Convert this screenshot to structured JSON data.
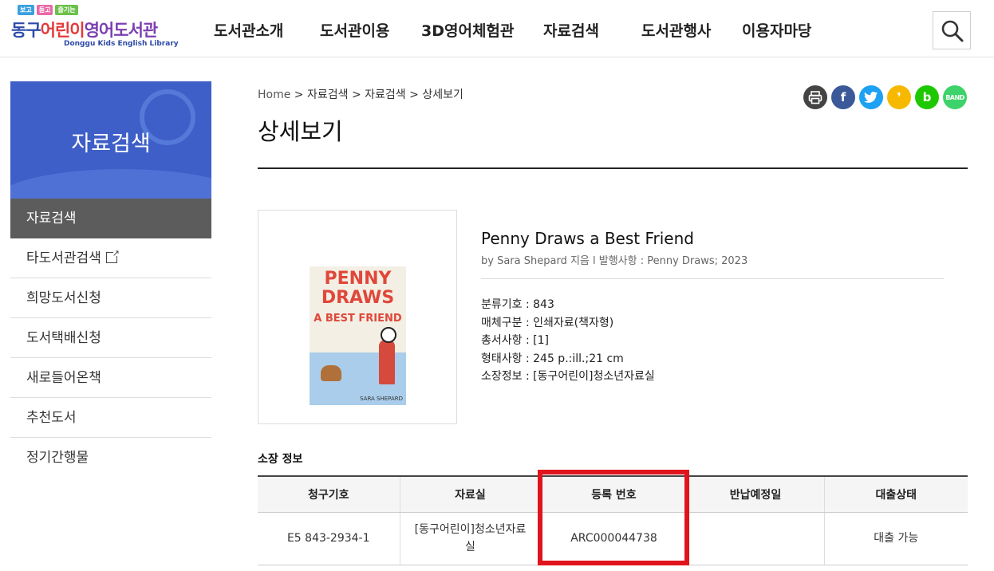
{
  "header": {
    "logo": {
      "tags": [
        "보고",
        "듣고",
        "즐기는"
      ],
      "title_part1": "동구",
      "title_part2": "어린이",
      "title_part3": "영어도서관",
      "subtitle": "Donggu Kids English Library"
    },
    "nav": [
      "도서관소개",
      "도서관이용",
      "3D영어체험관",
      "자료검색",
      "도서관행사",
      "이용자마당"
    ]
  },
  "sidebar": {
    "title": "자료검색",
    "items": [
      {
        "label": "자료검색"
      },
      {
        "label": "타도서관검색"
      },
      {
        "label": "희망도서신청"
      },
      {
        "label": "도서택배신청"
      },
      {
        "label": "새로들어온책"
      },
      {
        "label": "추천도서"
      },
      {
        "label": "정기간행물"
      }
    ]
  },
  "breadcrumb": {
    "home": "Home",
    "sep": " > ",
    "items": [
      "자료검색",
      "자료검색",
      "상세보기"
    ]
  },
  "page_title": "상세보기",
  "share": {
    "icons": [
      "print-icon",
      "facebook-icon",
      "twitter-icon",
      "kakaostory-icon",
      "blog-icon",
      "band-icon"
    ],
    "facebook": "f",
    "kakaostory": "❜",
    "blog": "b",
    "band": "BAND",
    "colors": {
      "print": "#444444",
      "facebook": "#3b5998",
      "twitter": "#1da1f2",
      "kakaostory": "#f7b900",
      "blog": "#1ec800",
      "band": "#3dd36a"
    }
  },
  "book": {
    "cover": {
      "line1": "PENNY",
      "line2": "DRAWS",
      "line3": "A BEST FRIEND",
      "author": "SARA SHEPARD"
    },
    "title": "Penny Draws a Best Friend",
    "meta": "by Sara Shepard 지음 l 발행사항 : Penny Draws; 2023",
    "details": [
      "분류기호 : 843",
      "매체구분 : 인쇄자료(책자형)",
      "총서사항 : [1]",
      "형태사항 : 245 p.:ill.;21 cm",
      "소장정보 : [동구어린이]청소년자료실"
    ]
  },
  "holdings": {
    "title": "소장 정보",
    "headers": [
      "청구기호",
      "자료실",
      "등록 번호",
      "반납예정일",
      "대출상태"
    ],
    "rows": [
      [
        "E5 843-2934-1",
        "[동구어린이]청소년자료실",
        "ARC000044738",
        "",
        "대출 가능"
      ]
    ],
    "highlight_color": "#e0141c"
  }
}
